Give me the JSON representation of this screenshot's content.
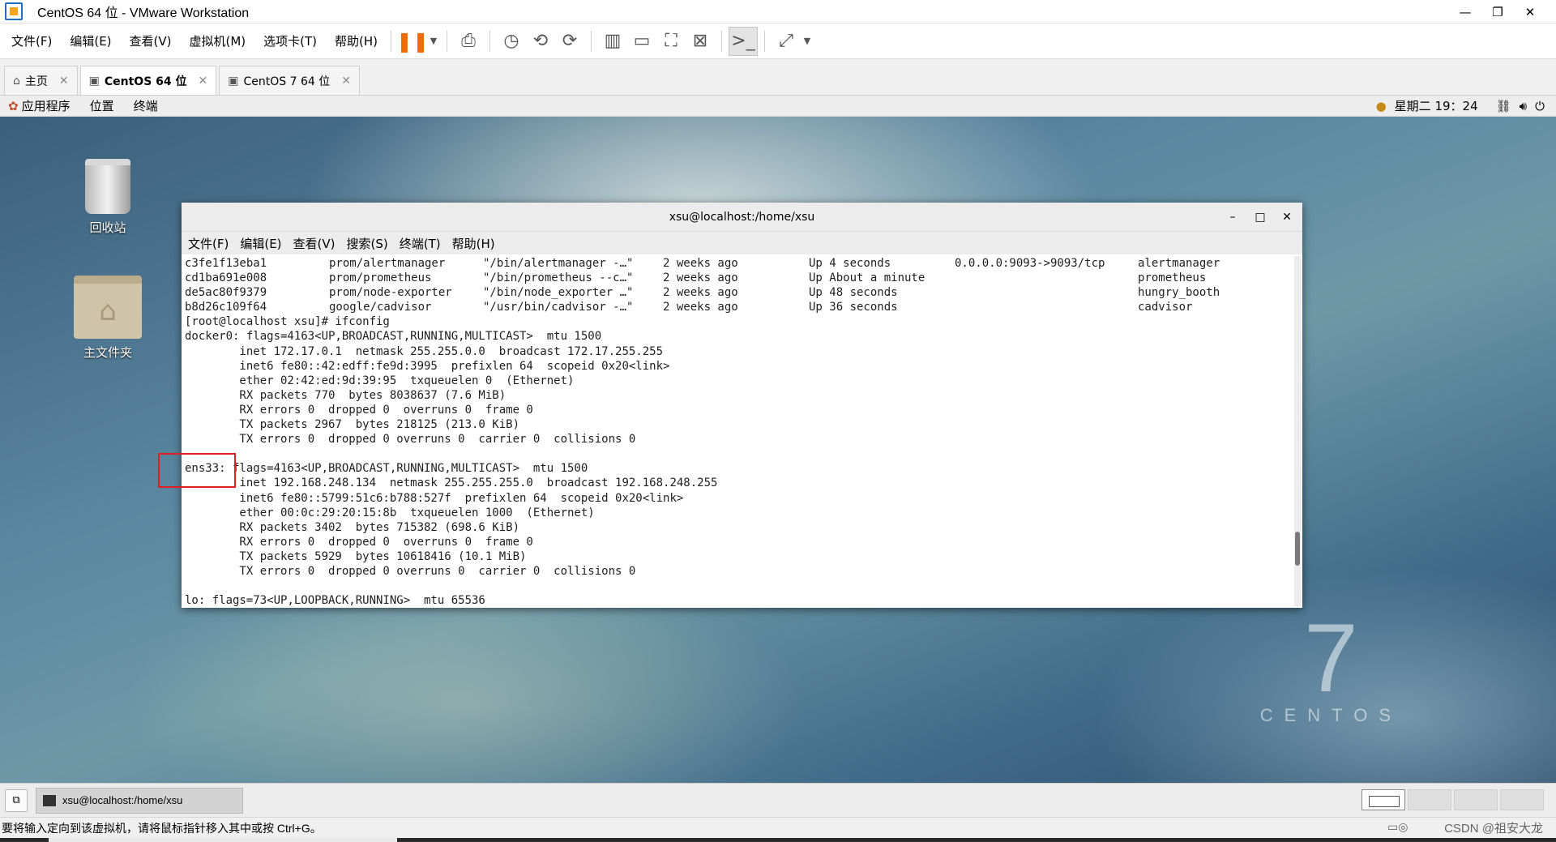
{
  "window": {
    "title": "CentOS 64 位 - VMware Workstation",
    "controls": [
      "—",
      "❐",
      "✕"
    ]
  },
  "menubar": {
    "items": [
      "文件(F)",
      "编辑(E)",
      "查看(V)",
      "虚拟机(M)",
      "选项卡(T)",
      "帮助(H)"
    ]
  },
  "toolbar": {
    "icons": [
      "pause-icon",
      "send-ctrl-alt-del-icon",
      "snapshot-icon",
      "revert-snapshot-icon",
      "snapshot-manager-icon",
      "show-library-icon",
      "thumbnail-bar-icon",
      "fullscreen-icon",
      "unity-icon",
      "console-view-icon",
      "stretch-icon"
    ]
  },
  "tabs": [
    {
      "label": "主页",
      "icon": "home-icon"
    },
    {
      "label": "CentOS 64 位",
      "icon": "vm-icon",
      "active": true
    },
    {
      "label": "CentOS 7 64 位",
      "icon": "vm-icon"
    }
  ],
  "gnome_top": {
    "apps": "应用程序",
    "places": "位置",
    "terminal": "终端",
    "clock": "星期二 19：24"
  },
  "desktop": {
    "trash_label": "回收站",
    "home_label": "主文件夹",
    "logo_number": "7",
    "logo_word": "CENTOS"
  },
  "terminal": {
    "title": "xsu@localhost:/home/xsu",
    "controls": [
      "–",
      "□",
      "✕"
    ],
    "menu": [
      "文件(F)",
      "编辑(E)",
      "查看(V)",
      "搜索(S)",
      "终端(T)",
      "帮助(H)"
    ],
    "ps_rows": [
      [
        "c3fe1f13eba1",
        "prom/alertmanager",
        "\"/bin/alertmanager -…\"",
        "2 weeks ago",
        "Up 4 seconds",
        "0.0.0.0:9093->9093/tcp",
        "alertmanager"
      ],
      [
        "cd1ba691e008",
        "prom/prometheus",
        "\"/bin/prometheus --c…\"",
        "2 weeks ago",
        "Up About a minute",
        "",
        "prometheus"
      ],
      [
        "de5ac80f9379",
        "prom/node-exporter",
        "\"/bin/node_exporter …\"",
        "2 weeks ago",
        "Up 48 seconds",
        "",
        "hungry_booth"
      ],
      [
        "b8d26c109f64",
        "google/cadvisor",
        "\"/usr/bin/cadvisor -…\"",
        "2 weeks ago",
        "Up 36 seconds",
        "",
        "cadvisor"
      ]
    ],
    "lines": [
      "[root@localhost xsu]# ifconfig",
      "docker0: flags=4163<UP,BROADCAST,RUNNING,MULTICAST>  mtu 1500",
      "        inet 172.17.0.1  netmask 255.255.0.0  broadcast 172.17.255.255",
      "        inet6 fe80::42:edff:fe9d:3995  prefixlen 64  scopeid 0x20<link>",
      "        ether 02:42:ed:9d:39:95  txqueuelen 0  (Ethernet)",
      "        RX packets 770  bytes 8038637 (7.6 MiB)",
      "        RX errors 0  dropped 0  overruns 0  frame 0",
      "        TX packets 2967  bytes 218125 (213.0 KiB)",
      "        TX errors 0  dropped 0 overruns 0  carrier 0  collisions 0",
      "",
      "ens33: flags=4163<UP,BROADCAST,RUNNING,MULTICAST>  mtu 1500",
      "        inet 192.168.248.134  netmask 255.255.255.0  broadcast 192.168.248.255",
      "        inet6 fe80::5799:51c6:b788:527f  prefixlen 64  scopeid 0x20<link>",
      "        ether 00:0c:29:20:15:8b  txqueuelen 1000  (Ethernet)",
      "        RX packets 3402  bytes 715382 (698.6 KiB)",
      "        RX errors 0  dropped 0  overruns 0  frame 0",
      "        TX packets 5929  bytes 10618416 (10.1 MiB)",
      "        TX errors 0  dropped 0 overruns 0  carrier 0  collisions 0",
      "",
      "lo: flags=73<UP,LOOPBACK,RUNNING>  mtu 65536"
    ]
  },
  "gnome_bottom": {
    "task_label": "xsu@localhost:/home/xsu"
  },
  "statusbar": {
    "hint": "要将输入定向到该虚拟机，请将鼠标指针移入其中或按 Ctrl+G。",
    "watermark": "CSDN @祖安大龙"
  },
  "colors": {
    "highlight_box": "#e02020",
    "pause_accent": "#f06a00"
  }
}
